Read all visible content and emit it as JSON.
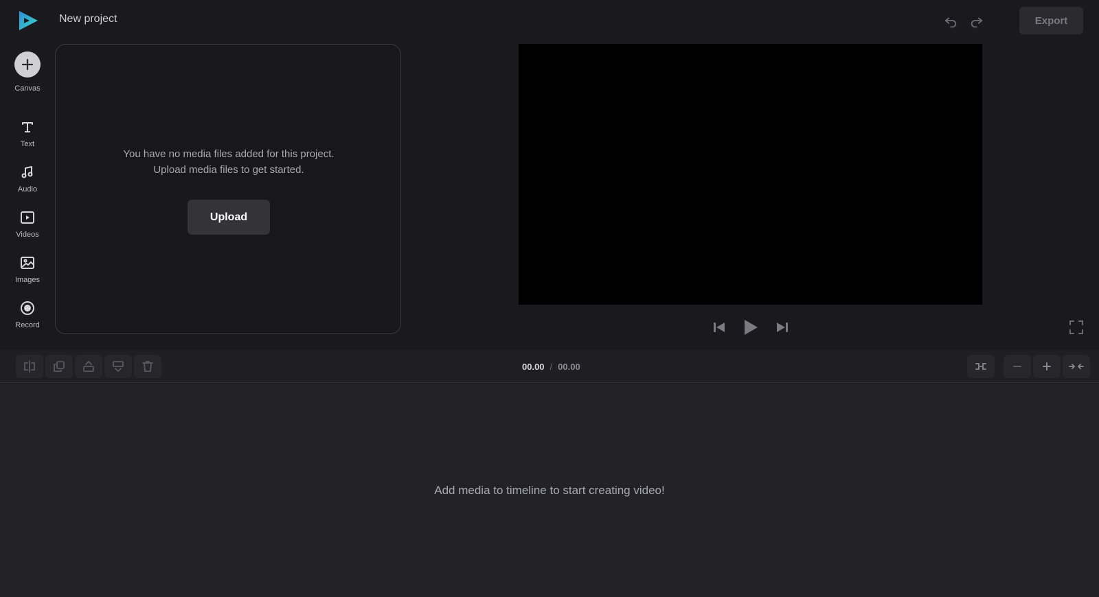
{
  "header": {
    "project_title": "New project",
    "export_label": "Export"
  },
  "sidebar": {
    "items": [
      {
        "label": "Canvas",
        "icon": "plus-icon"
      },
      {
        "label": "Text",
        "icon": "text-icon"
      },
      {
        "label": "Audio",
        "icon": "music-note-icon"
      },
      {
        "label": "Videos",
        "icon": "video-icon"
      },
      {
        "label": "Images",
        "icon": "image-icon"
      },
      {
        "label": "Record",
        "icon": "record-icon"
      }
    ]
  },
  "media_panel": {
    "empty_line1": "You have no media files added for this project.",
    "empty_line2": "Upload media files to get started.",
    "upload_label": "Upload"
  },
  "toolbar": {
    "current_time": "00.00",
    "separator": "/",
    "total_time": "00.00"
  },
  "timeline": {
    "empty_message": "Add media to timeline to start creating video!"
  },
  "colors": {
    "background": "#1a1a1e",
    "panel_border": "#3a3a40",
    "preview": "#000000",
    "logo_blue": "#2f8fd8",
    "logo_teal": "#3ad6c5"
  }
}
